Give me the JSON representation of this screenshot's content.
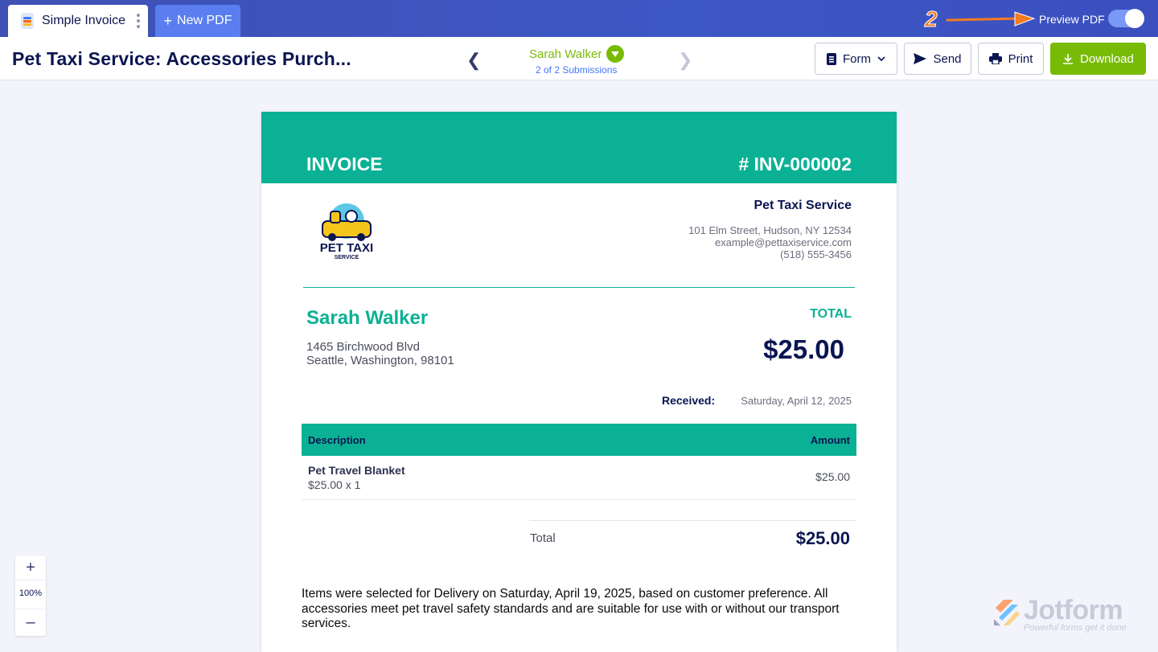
{
  "tabs": {
    "active_label": "Simple Invoice",
    "new_pdf_label": "New PDF"
  },
  "annotation": {
    "step_number": "2"
  },
  "preview": {
    "label": "Preview PDF",
    "enabled": true
  },
  "header": {
    "title": "Pet Taxi Service: Accessories Purch...",
    "submission_name": "Sarah Walker",
    "submission_count": "2 of 2 Submissions"
  },
  "toolbar": {
    "form_label": "Form",
    "send_label": "Send",
    "print_label": "Print",
    "download_label": "Download"
  },
  "invoice": {
    "title": "INVOICE",
    "number": "# INV-000002",
    "logo_text_main": "PET TAXI",
    "logo_text_sub": "SERVICE",
    "company_name": "Pet Taxi Service",
    "company_address": "101 Elm Street, Hudson, NY 12534",
    "company_email": "example@pettaxiservice.com",
    "company_phone": "(518) 555-3456",
    "customer_name": "Sarah Walker",
    "customer_address_1": "1465 Birchwood Blvd",
    "customer_address_2": "Seattle, Washington, 98101",
    "total_label": "TOTAL",
    "total_amount": "$25.00",
    "received_label": "Received:",
    "received_date": "Saturday, April 12, 2025",
    "table": {
      "col_description": "Description",
      "col_amount": "Amount",
      "rows": [
        {
          "name": "Pet Travel Blanket",
          "qty": "$25.00 x 1",
          "amount": "$25.00"
        }
      ]
    },
    "summary_label": "Total",
    "summary_value": "$25.00",
    "note": "Items were selected for Delivery on Saturday, April 19, 2025, based on customer preference. All accessories meet pet travel safety standards and are suitable for use with or without our transport services."
  },
  "zoom": {
    "in_label": "+",
    "level": "100%",
    "out_label": "–"
  },
  "watermark": {
    "brand": "Jotform",
    "tagline": "Powerful forms get it done"
  },
  "colors": {
    "topbar": "#3f51b5",
    "accent_teal": "#0bb194",
    "accent_green": "#78bb07",
    "link_blue": "#4277ff",
    "navy": "#0a1551"
  },
  "icons": [
    "document-icon",
    "kebab-icon",
    "plus-icon",
    "arrow-icon",
    "chevron-left-icon",
    "chevron-right-icon",
    "chevron-down-icon",
    "form-icon",
    "send-icon",
    "print-icon",
    "download-icon",
    "jotform-logo-icon"
  ]
}
